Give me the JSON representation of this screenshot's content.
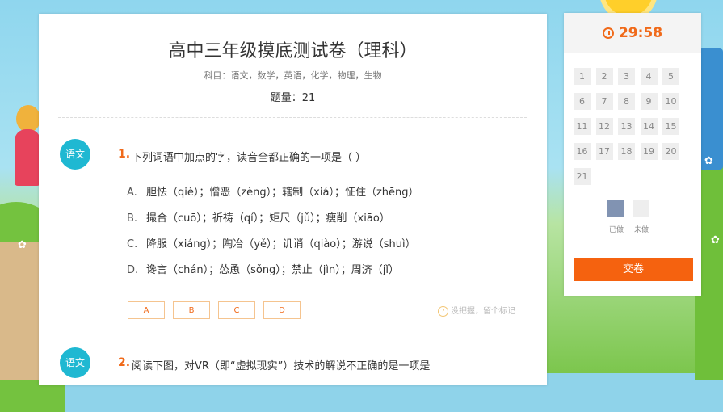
{
  "exam": {
    "title": "高中三年级摸底测试卷（理科）",
    "subjects": "科目：语文，数学，英语，化学，物理，生物",
    "count": "题量：21"
  },
  "questions": [
    {
      "badge": "语文",
      "number": "1.",
      "text": "下列词语中加点的字，读音全都正确的一项是（ ）",
      "options": [
        {
          "letter": "A.",
          "text": "胆怯（qiè）；憎恶（zèng）；辖制（xiá）；怔住（zhēng）"
        },
        {
          "letter": "B.",
          "text": "撮合（cuō）；祈祷（qí）；矩尺（jǔ）；瘦削（xiāo）"
        },
        {
          "letter": "C.",
          "text": "降服（xiáng）；陶冶（yě）；讥诮（qiào）；游说（shuì）"
        },
        {
          "letter": "D.",
          "text": "谗言（chán）；怂恿（sǒng）；禁止（jìn）；周济（jǐ）"
        }
      ],
      "answers": [
        "A",
        "B",
        "C",
        "D"
      ],
      "mark_tip": "没把握，留个标记"
    },
    {
      "badge": "语文",
      "number": "2.",
      "text": "阅读下图，对VR（即“虚拟现实”）技术的解说不正确的是一项是"
    }
  ],
  "sidebar": {
    "timer": "29:58",
    "numbers": [
      "1",
      "2",
      "3",
      "4",
      "5",
      "6",
      "7",
      "8",
      "9",
      "10",
      "11",
      "12",
      "13",
      "14",
      "15",
      "16",
      "17",
      "18",
      "19",
      "20",
      "21"
    ],
    "legend_done": "已做",
    "legend_todo": "未做",
    "submit_label": "交卷"
  },
  "colors": {
    "accent": "#f06a1a",
    "badge": "#1fb8d2",
    "done": "#8193b2",
    "todo": "#eeeeee"
  }
}
